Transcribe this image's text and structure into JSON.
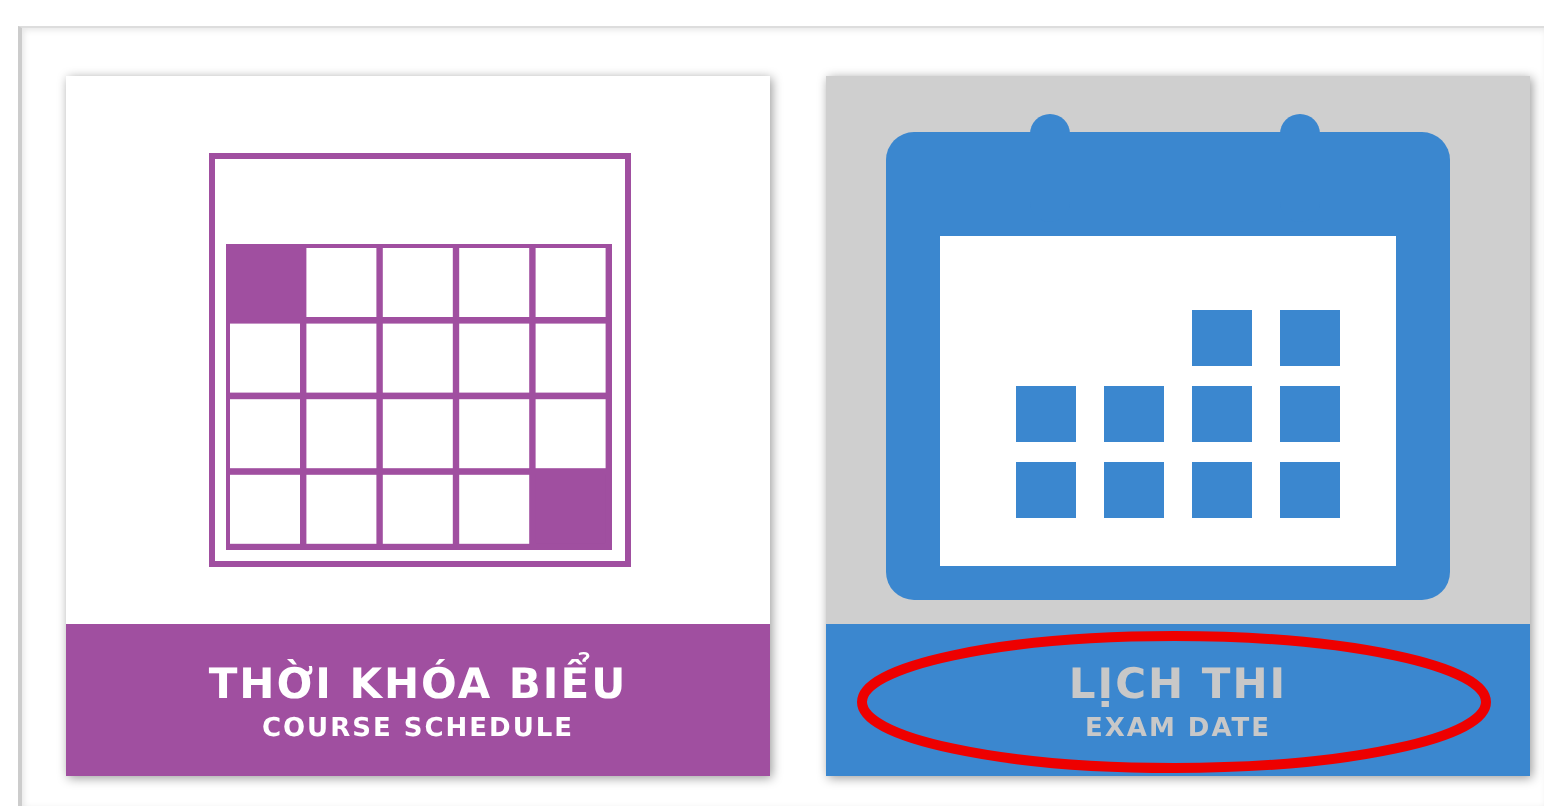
{
  "tiles": [
    {
      "kind": "grid",
      "title": "THỜI KHÓA BIỂU",
      "subtitle": "COURSE SCHEDULE",
      "selected": false,
      "circled": false
    },
    {
      "kind": "calendar",
      "title": "LỊCH THI",
      "subtitle": "EXAM DATE",
      "selected": true,
      "circled": true
    }
  ]
}
